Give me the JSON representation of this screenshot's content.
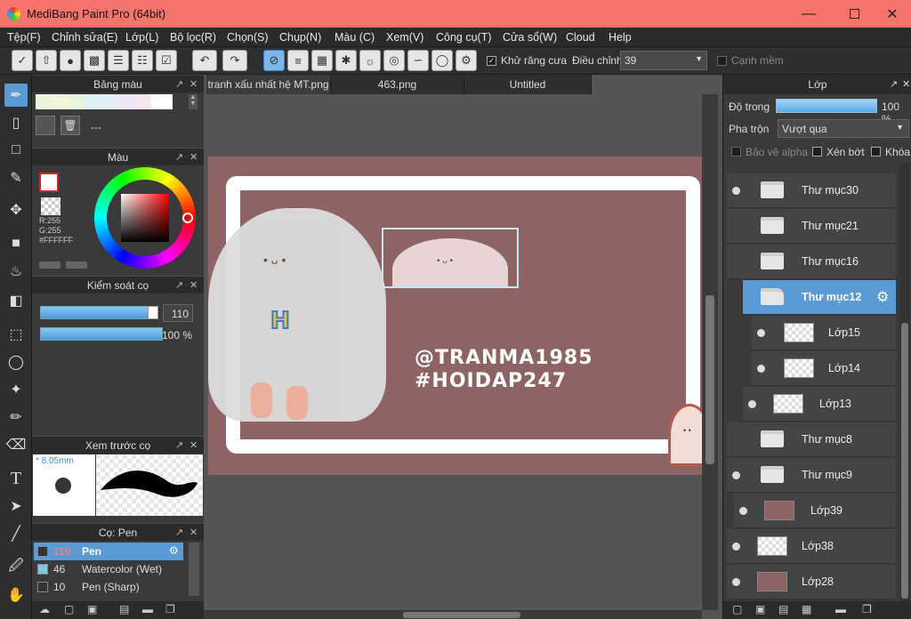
{
  "window": {
    "title": "MediBang Paint Pro (64bit)"
  },
  "menu": [
    "Tệp(F)",
    "Chỉnh sửa(E)",
    "Lớp(L)",
    "Bộ lọc(R)",
    "Chọn(S)",
    "Chụp(N)",
    "Màu (C)",
    "Xem(V)",
    "Công cụ(T)",
    "Cửa sổ(W)",
    "Cloud",
    "Help"
  ],
  "toolbar": {
    "antialias_label": "Khử răng cưa",
    "adjust_label": "Điều chỉnh",
    "adjust_value": "39",
    "soft_edge_label": "Cạnh mềm"
  },
  "palette": {
    "title": "Bảng màu",
    "none_label": "---"
  },
  "color": {
    "title": "Màu",
    "r": "R:255",
    "g": "G:255",
    "hex": "#FFFFFF"
  },
  "brush_control": {
    "title": "Kiểm soát cọ",
    "size": "110",
    "opacity": "100 %"
  },
  "brush_preview": {
    "title": "Xem trước cọ",
    "size": "* 8.05mm"
  },
  "brushes": {
    "title": "Cọ: Pen",
    "items": [
      {
        "size": "110",
        "name": "Pen",
        "color": "#333333"
      },
      {
        "size": "46",
        "name": "Watercolor (Wet)",
        "color": "#7ec8e3"
      },
      {
        "size": "10",
        "name": "Pen (Sharp)",
        "color": "#333333"
      }
    ]
  },
  "tabs": [
    "tranh xấu nhất hệ MT.png",
    "463.png",
    "Untitled"
  ],
  "canvas": {
    "line1": "@TRANMA1985",
    "line2": "#HOIDAP247",
    "bg": "#8e6363"
  },
  "layers_panel": {
    "title": "Lớp",
    "opacity_label": "Độ trong",
    "opacity_value": "100 %",
    "blend_label": "Pha trộn",
    "blend_value": "Vượt qua",
    "alpha_label": "Bảo vệ alpha",
    "clip_label": "Xén bớt",
    "lock_label": "Khóa",
    "layers": [
      {
        "name": "Thư mục30",
        "type": "folder",
        "visible": true,
        "indent": 0
      },
      {
        "name": "Thư mục21",
        "type": "folder",
        "visible": false,
        "indent": 0
      },
      {
        "name": "Thư mục16",
        "type": "folder",
        "visible": false,
        "indent": 0
      },
      {
        "name": "Thư mục12",
        "type": "folder",
        "visible": false,
        "indent": 0,
        "selected": true
      },
      {
        "name": "Lớp15",
        "type": "layer",
        "visible": true,
        "indent": 2
      },
      {
        "name": "Lớp14",
        "type": "layer",
        "visible": true,
        "indent": 2
      },
      {
        "name": "Lớp13",
        "type": "layer",
        "visible": true,
        "indent": 1
      },
      {
        "name": "Thư mục8",
        "type": "folder",
        "visible": false,
        "indent": 0
      },
      {
        "name": "Thư mục9",
        "type": "folder",
        "visible": true,
        "indent": 0
      },
      {
        "name": "Lớp39",
        "type": "layer",
        "visible": true,
        "indent": 1
      },
      {
        "name": "Lớp38",
        "type": "layer",
        "visible": true,
        "indent": 0
      },
      {
        "name": "Lớp28",
        "type": "layer",
        "visible": true,
        "indent": 0
      }
    ]
  }
}
